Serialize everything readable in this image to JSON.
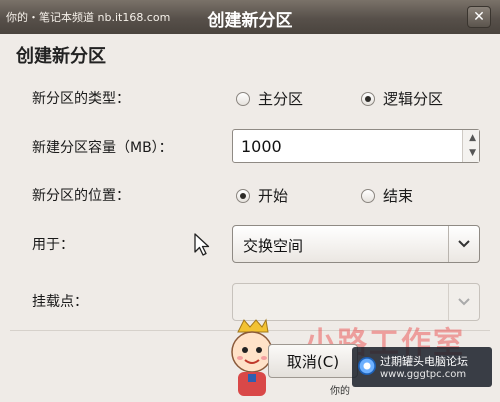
{
  "window": {
    "title": "创建新分区",
    "watermark_top": "你的・笔记本频道  nb.it168.com",
    "close_label": "✕"
  },
  "dialog": {
    "heading": "创建新分区",
    "type_label": "新分区的类型：",
    "type_options": [
      {
        "label": "主分区",
        "checked": false
      },
      {
        "label": "逻辑分区",
        "checked": true
      }
    ],
    "size_label": "新建分区容量（MB）：",
    "size_value": "1000",
    "location_label": "新分区的位置：",
    "location_options": [
      {
        "label": "开始",
        "checked": true
      },
      {
        "label": "结束",
        "checked": false
      }
    ],
    "use_label": "用于：",
    "use_value": "交换空间",
    "mount_label": "挂载点：",
    "mount_value": "",
    "cancel_label": "取消(C)"
  },
  "watermarks": {
    "brand": "小路工作室",
    "forum_name": "过期罐头电脑论坛",
    "forum_url": "www.gggtpc.com",
    "bottom_text": "你的"
  }
}
